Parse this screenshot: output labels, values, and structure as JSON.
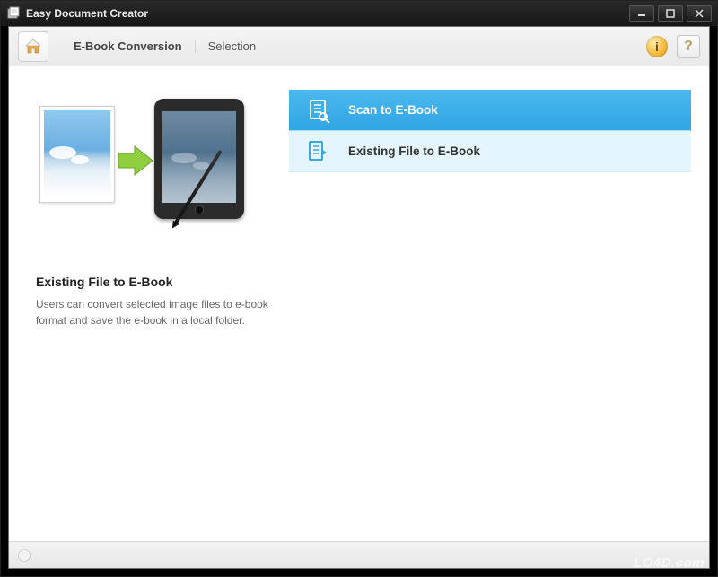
{
  "window": {
    "title": "Easy Document Creator"
  },
  "toolbar": {
    "breadcrumb_section": "E-Book Conversion",
    "breadcrumb_step": "Selection",
    "info_label": "i",
    "help_label": "?"
  },
  "options": [
    {
      "label": "Scan to E-Book",
      "selected": true,
      "icon": "scan-document-icon"
    },
    {
      "label": "Existing File to E-Book",
      "selected": false,
      "icon": "file-to-ebook-icon"
    }
  ],
  "description": {
    "title": "Existing File to E-Book",
    "body": "Users can convert selected image files to e-book format and save the e-book in a local folder."
  },
  "watermark": "LO4D.com"
}
